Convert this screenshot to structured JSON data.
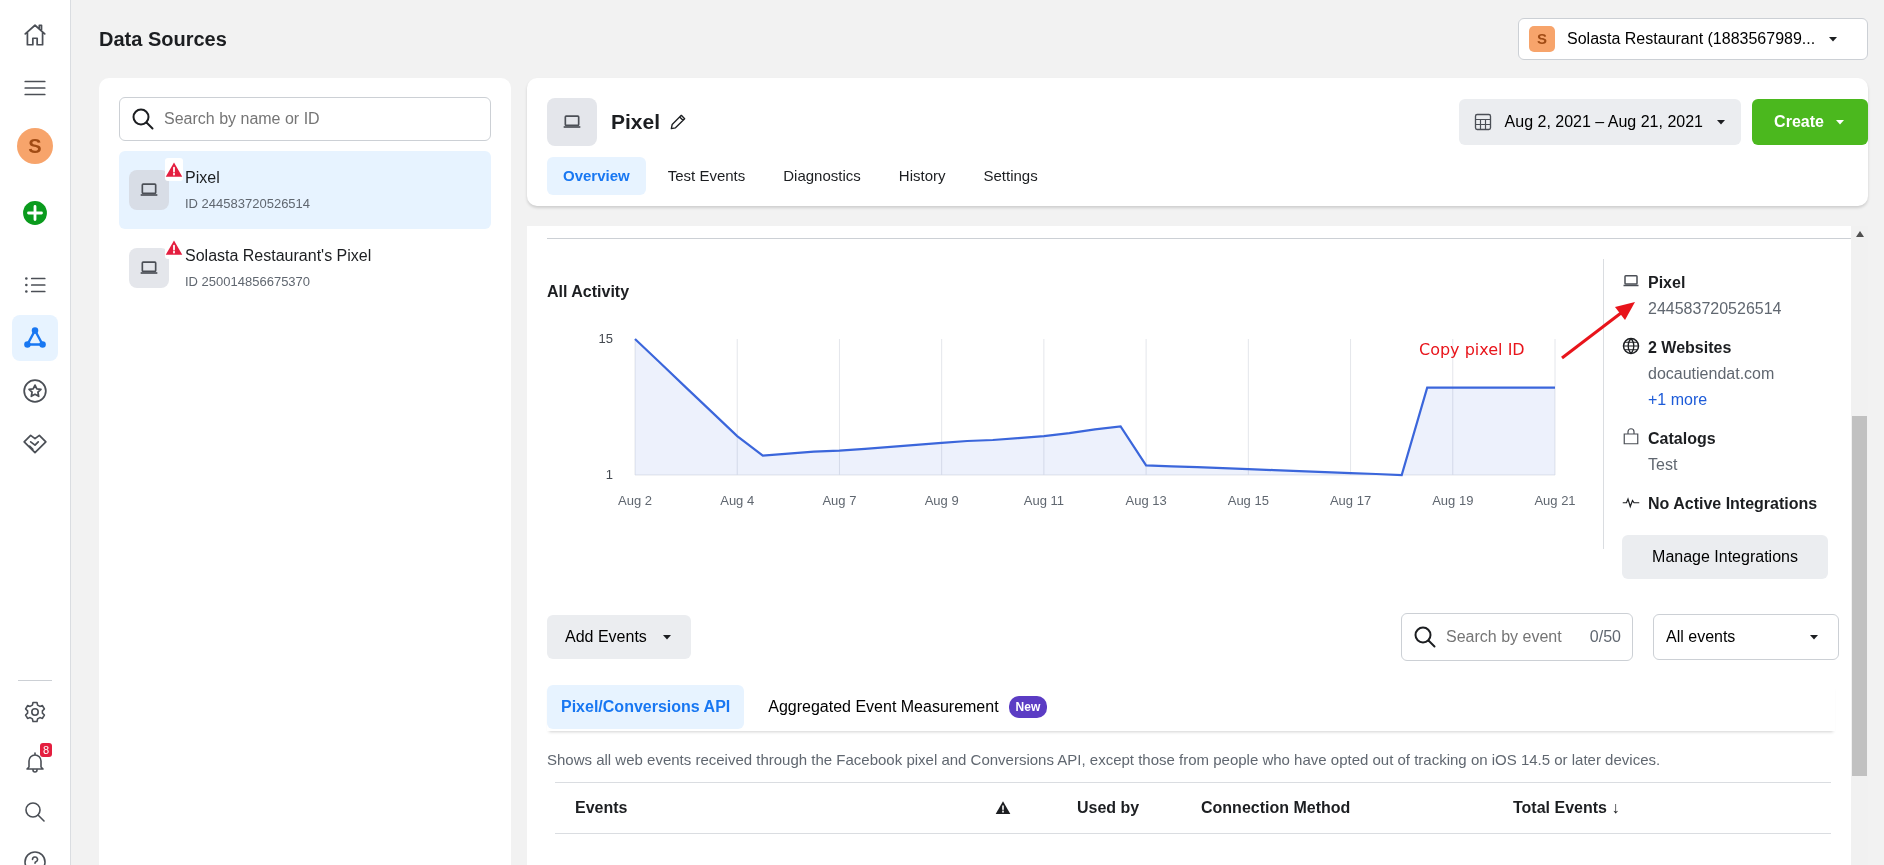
{
  "rail": {
    "avatar": "S",
    "top": [
      {
        "selected": false
      },
      {
        "selected": false
      },
      {
        "selected": false
      },
      {
        "selected": false
      },
      {
        "selected": true
      },
      {
        "selected": false
      },
      {
        "selected": false
      }
    ],
    "bottom": [
      {
        "selected": false
      },
      {
        "selected": false
      },
      {
        "selected": false
      },
      {
        "selected": false
      }
    ],
    "notifications": "8"
  },
  "page": {
    "title": "Data Sources"
  },
  "account": {
    "avatar": "S",
    "name": "Solasta Restaurant (1883567989..."
  },
  "sources": {
    "search": {
      "placeholder": "Search by name or ID"
    },
    "items": [
      {
        "name": "Pixel",
        "id": "ID 244583720526514",
        "warning": true,
        "selected": true
      },
      {
        "name": "Solasta Restaurant's Pixel",
        "id": "ID 250014856675370",
        "warning": true,
        "selected": false
      }
    ]
  },
  "detail": {
    "title": "Pixel",
    "date_range": "Aug 2, 2021 – Aug 21, 2021",
    "create": "Create",
    "tabs": [
      {
        "label": "Overview",
        "selected": true
      },
      {
        "label": "Test Events",
        "selected": false
      },
      {
        "label": "Diagnostics",
        "selected": false
      },
      {
        "label": "History",
        "selected": false
      },
      {
        "label": "Settings",
        "selected": false
      }
    ]
  },
  "activity": {
    "title": "All Activity",
    "annotation": "Copy pixel ID",
    "chart_data": {
      "type": "area",
      "categories": [
        "Aug 2",
        null,
        null,
        null,
        "Aug 4",
        null,
        null,
        null,
        "Aug 7",
        null,
        null,
        null,
        "Aug 9",
        null,
        null,
        null,
        "Aug 11",
        null,
        null,
        null,
        "Aug 13",
        null,
        null,
        null,
        "Aug 15",
        null,
        null,
        null,
        "Aug 17",
        null,
        null,
        null,
        "Aug 19",
        null,
        null,
        null,
        "Aug 21"
      ],
      "series": [
        {
          "color": "#3b66db",
          "values": [
            15,
            12.5,
            10,
            7.5,
            5,
            3,
            3.2,
            3.4,
            3.5,
            3.7,
            3.9,
            4.1,
            4.3,
            4.5,
            4.6,
            4.8,
            5,
            5.3,
            5.7,
            6,
            2,
            1.9,
            1.8,
            1.7,
            1.6,
            1.5,
            1.4,
            1.3,
            1.2,
            1.1,
            1,
            10,
            10,
            10,
            10,
            10,
            10
          ]
        }
      ],
      "ylim": [
        1,
        15
      ],
      "yticks": [
        1,
        15
      ],
      "grid": true
    }
  },
  "info": {
    "items": [
      {
        "kind": "pixel",
        "title": "Pixel",
        "lines": [
          "244583720526514"
        ]
      },
      {
        "kind": "websites",
        "title": "2 Websites",
        "lines": [
          "docautiendat.com"
        ],
        "link": "+1 more"
      },
      {
        "kind": "catalogs",
        "title": "Catalogs",
        "lines": [
          "Test"
        ]
      },
      {
        "kind": "integrations",
        "title": "No Active Integrations"
      }
    ],
    "button": "Manage Integrations"
  },
  "events": {
    "add_button": "Add Events",
    "search": {
      "placeholder": "Search by event",
      "counter": "0/50"
    },
    "filter": "All events",
    "tabs": [
      {
        "label": "Pixel/Conversions API",
        "selected": true
      },
      {
        "label": "Aggregated Event Measurement",
        "badge": "New",
        "selected": false
      }
    ],
    "description": "Shows all web events received through the Facebook pixel and Conversions API, except those from people who have opted out of tracking on iOS 14.5 or later devices.",
    "columns": [
      {
        "kind": "text",
        "label": "Events"
      },
      {
        "kind": "warning"
      },
      {
        "kind": "text",
        "label": "Used by"
      },
      {
        "kind": "text",
        "label": "Connection Method"
      },
      {
        "kind": "text",
        "label": "Total Events ↓"
      }
    ]
  }
}
